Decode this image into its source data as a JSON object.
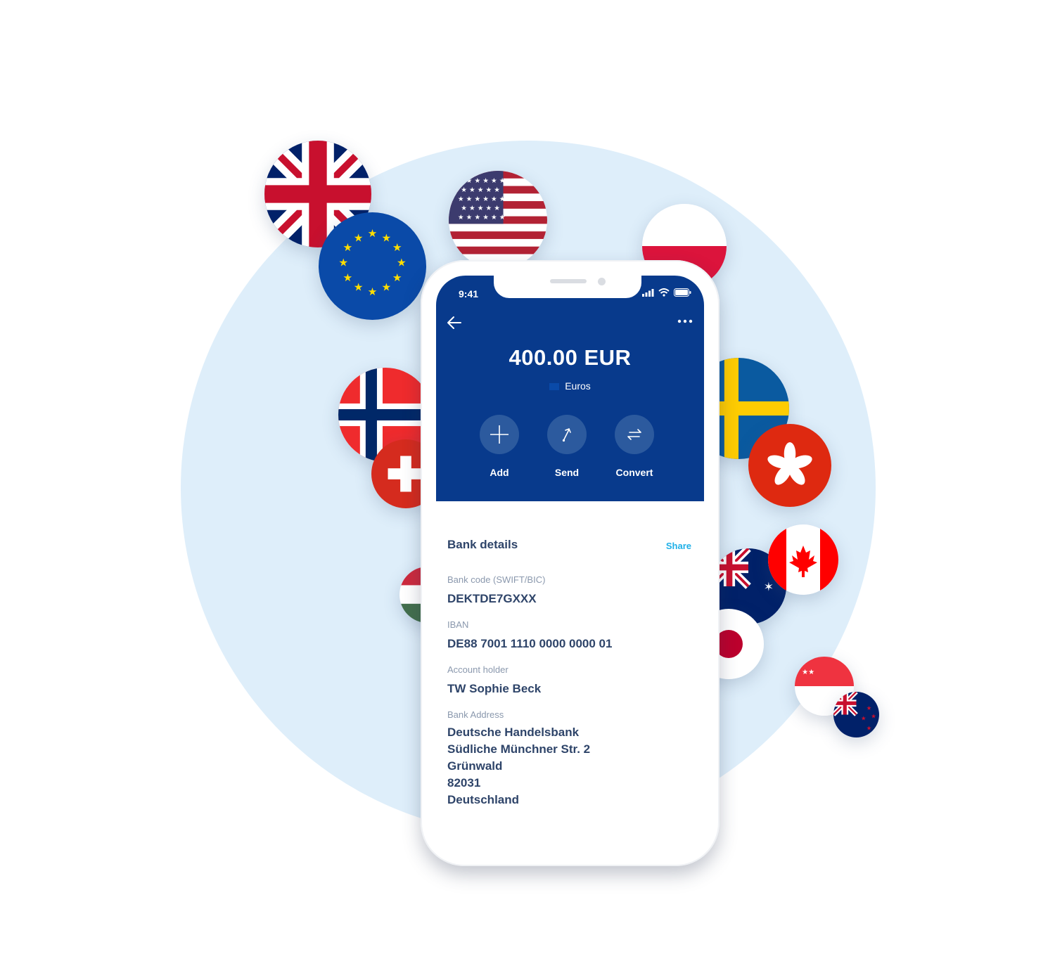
{
  "status_bar": {
    "time": "9:41"
  },
  "account": {
    "balance": "400.00 EUR",
    "currency_name": "Euros"
  },
  "actions": [
    {
      "label": "Add",
      "icon": "plus-icon"
    },
    {
      "label": "Send",
      "icon": "send-arrow-icon"
    },
    {
      "label": "Convert",
      "icon": "convert-arrows-icon"
    }
  ],
  "bank_details": {
    "title": "Bank details",
    "share_label": "Share",
    "bank_code_label": "Bank code (SWIFT/BIC)",
    "bank_code": "DEKTDE7GXXX",
    "iban_label": "IBAN",
    "iban": "DE88 7001 1110 0000 0000 01",
    "holder_label": "Account holder",
    "holder": "TW Sophie Beck",
    "address_label": "Bank Address",
    "address": [
      "Deutsche Handelsbank",
      "Südliche Münchner Str. 2",
      "Grünwald",
      "82031",
      "Deutschland"
    ]
  },
  "decor_flags": [
    "uk-flag",
    "eu-flag",
    "us-flag",
    "poland-flag",
    "norway-flag",
    "switzerland-flag",
    "sweden-flag",
    "hong-kong-flag",
    "canada-flag",
    "australia-flag",
    "japan-flag",
    "hungary-flag",
    "singapore-flag",
    "new-zealand-flag"
  ],
  "colors": {
    "header_blue": "#083a8c",
    "text_navy": "#2e4469",
    "share_blue": "#1fb0e8",
    "bg_circle": "#deeefa"
  }
}
